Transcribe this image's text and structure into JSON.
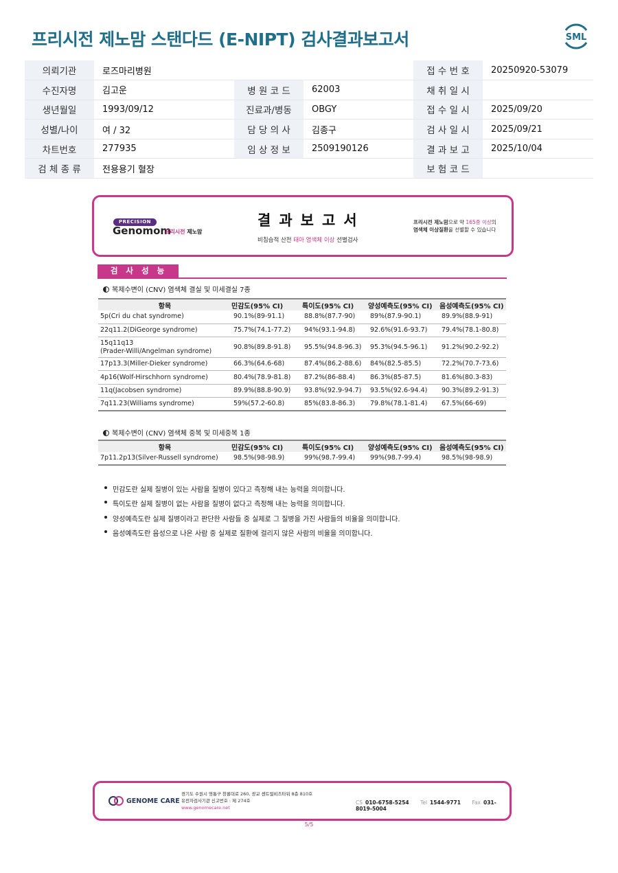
{
  "title": "프리시전 제노맘 스탠다드 (E-NIPT) 검사결과보고서",
  "logo_text": "SML",
  "info": {
    "rows": [
      [
        {
          "l": "의뢰기관",
          "v": "로즈마리병원"
        },
        {
          "l": "",
          "v": ""
        },
        {
          "l": "접 수 번 호",
          "v": "20250920-53079"
        }
      ],
      [
        {
          "l": "수진자명",
          "v": "김고운"
        },
        {
          "l": "병 원 코 드",
          "v": "62003"
        },
        {
          "l": "채 취 일 시",
          "v": ""
        }
      ],
      [
        {
          "l": "생년월일",
          "v": "1993/09/12"
        },
        {
          "l": "진료과/병동",
          "v": "OBGY"
        },
        {
          "l": "접 수 일 시",
          "v": "2025/09/20"
        }
      ],
      [
        {
          "l": "성별/나이",
          "v": "여 / 32"
        },
        {
          "l": "담 당 의 사",
          "v": "김종구"
        },
        {
          "l": "검 사 일 시",
          "v": "2025/09/21"
        }
      ],
      [
        {
          "l": "차트번호",
          "v": "277935"
        },
        {
          "l": "임 상 정 보",
          "v": "2509190126"
        },
        {
          "l": "결 과 보 고",
          "v": "2025/10/04"
        }
      ],
      [
        {
          "l": "검 체 종 류",
          "v": "전용용기 혈장"
        },
        {
          "l": "",
          "v": ""
        },
        {
          "l": "보 험 코 드",
          "v": ""
        }
      ]
    ]
  },
  "report_header": {
    "badge": "PRECISION",
    "brand": "Genomom",
    "brand_sub1": "프리시전",
    "brand_sub2": "제노맘",
    "title": "결과보고서",
    "subtitle_pre": "비침습적 산전 ",
    "subtitle_hl": "태아 염색체 이상",
    "subtitle_post": " 선별검사",
    "note_a": "프리시전 제노맘",
    "note_b": "으로 약 ",
    "note_c": "165종 이상",
    "note_d": "의",
    "note_e": "염색체 이상질환",
    "note_f": "을 선별할 수 있습니다"
  },
  "section_title": "검사성능",
  "table1": {
    "heading": "복제수변이 (CNV) 염색체 결실 및 미세결실 7종",
    "headers": [
      "항목",
      "민감도(95% CI)",
      "특이도(95% CI)",
      "양성예측도(95% CI)",
      "음성예측도(95% CI)"
    ],
    "rows": [
      [
        "5p(Cri du chat syndrome)",
        "90.1%(89-91.1)",
        "88.8%(87.7-90)",
        "89%(87.9-90.1)",
        "89.9%(88.9-91)"
      ],
      [
        "22q11.2(DiGeorge syndrome)",
        "75.7%(74.1-77.2)",
        "94%(93.1-94.8)",
        "92.6%(91.6-93.7)",
        "79.4%(78.1-80.8)"
      ],
      [
        "15q11q13\n(Prader-Willi/Angelman syndrome)",
        "90.8%(89.8-91.8)",
        "95.5%(94.8-96.3)",
        "95.3%(94.5-96.1)",
        "91.2%(90.2-92.2)"
      ],
      [
        "17p13.3(Miller-Dieker syndrome)",
        "66.3%(64.6-68)",
        "87.4%(86.2-88.6)",
        "84%(82.5-85.5)",
        "72.2%(70.7-73.6)"
      ],
      [
        "4p16(Wolf-Hirschhorn syndrome)",
        "80.4%(78.9-81.8)",
        "87.2%(86-88.4)",
        "86.3%(85-87.5)",
        "81.6%(80.3-83)"
      ],
      [
        "11q(Jacobsen syndrome)",
        "89.9%(88.8-90.9)",
        "93.8%(92.9-94.7)",
        "93.5%(92.6-94.4)",
        "90.3%(89.2-91.3)"
      ],
      [
        "7q11.23(Williams syndrome)",
        "59%(57.2-60.8)",
        "85%(83.8-86.3)",
        "79.8%(78.1-81.4)",
        "67.5%(66-69)"
      ]
    ]
  },
  "table2": {
    "heading": "복제수변이 (CNV) 염색체 중복 및 미세중복 1종",
    "headers": [
      "항목",
      "민감도(95% CI)",
      "특이도(95% CI)",
      "양성예측도(95% CI)",
      "음성예측도(95% CI)"
    ],
    "rows": [
      [
        "7p11.2p13(Silver-Russell syndrome)",
        "98.5%(98-98.9)",
        "99%(98.7-99.4)",
        "99%(98.7-99.4)",
        "98.5%(98-98.9)"
      ]
    ]
  },
  "notes": [
    "민감도란 실제 질병이 있는 사람을 질병이 있다고 측정해 내는 능력을 의미합니다.",
    "특이도란 실제 질병이 없는 사람을 질병이 없다고 측정해 내는 능력을 의미합니다.",
    "양성예측도란 실제 질병이라고 판단한 사람들 중 실제로 그 질병을 가진 사람들의 비율을 의미합니다.",
    "음성예측도란 음성으로 나온 사람 중 실제로 질환에 걸리지 않은 사람의 비율을 의미합니다."
  ],
  "footer": {
    "company": "GENOME CARE",
    "address": "경기도 수원시 영통구 창룡대로 260, 광교 센트럴비즈타워 8층 810호",
    "license": "유전자검사기관 신고번호 : 제 274호",
    "url": "www.genomecare.net",
    "cs_label": "CS",
    "cs": "010-6758-5254",
    "tel_label": "Tel",
    "tel": "1544-9771",
    "fax_label": "Fax",
    "fax": "031-8019-5004"
  },
  "page_number": "5/5",
  "colors": {
    "accent": "#c8388a",
    "title": "#1f6f8b",
    "label_bg": "#eef2f6"
  }
}
